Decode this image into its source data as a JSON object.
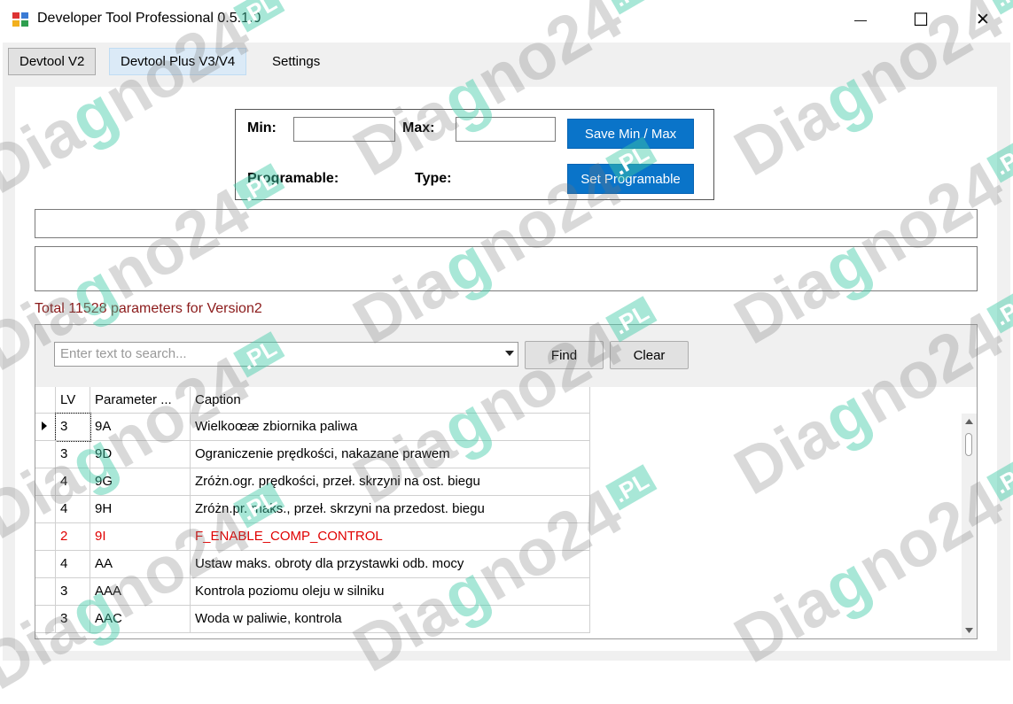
{
  "window": {
    "title": "Developer Tool Professional 0.5.1.0",
    "minimize_glyph": "—",
    "maximize_glyph": "☐",
    "close_glyph": "✕"
  },
  "tabs": [
    {
      "label": "Devtool V2"
    },
    {
      "label": "Devtool Plus V3/V4"
    },
    {
      "label": "Settings"
    }
  ],
  "minmax": {
    "min_label": "Min:",
    "max_label": "Max:",
    "min_value": "",
    "max_value": "",
    "programable_label": "Programable:",
    "type_label": "Type:",
    "save_button": "Save Min / Max",
    "set_button": "Set Programable"
  },
  "summary": "Total 11528 parameters for Version2",
  "grid": {
    "search_placeholder": "Enter text to search...",
    "find_button": "Find",
    "clear_button": "Clear",
    "columns": [
      "LV",
      "Parameter ...",
      "Caption"
    ],
    "rows": [
      {
        "lv": "3",
        "param": "9A",
        "caption": "Wielkoœæ zbiornika paliwa",
        "red": false,
        "current": true
      },
      {
        "lv": "3",
        "param": "9D",
        "caption": "Ograniczenie prędkości, nakazane prawem",
        "red": false,
        "current": false
      },
      {
        "lv": "4",
        "param": "9G",
        "caption": "Zróżn.ogr. prędkości, przeł. skrzyni na ost. biegu",
        "red": false,
        "current": false
      },
      {
        "lv": "4",
        "param": "9H",
        "caption": "Zróżn.pr. maks., przeł. skrzyni na przedost. biegu",
        "red": false,
        "current": false
      },
      {
        "lv": "2",
        "param": "9I",
        "caption": "F_ENABLE_COMP_CONTROL",
        "red": true,
        "current": false
      },
      {
        "lv": "4",
        "param": "AA",
        "caption": "Ustaw maks. obroty dla przystawki odb. mocy",
        "red": false,
        "current": false
      },
      {
        "lv": "3",
        "param": "AAA",
        "caption": "Kontrola poziomu oleju w silniku",
        "red": false,
        "current": false
      },
      {
        "lv": "3",
        "param": "AAC",
        "caption": "Woda w paliwie, kontrola",
        "red": false,
        "current": false
      }
    ]
  },
  "watermark": {
    "text": "Diagno24",
    "suffix": ".PL",
    "accent": "#3ec9a7"
  },
  "colors": {
    "button_blue": "#0a74c9",
    "summary_red": "#8b1a1a",
    "row_red": "#e00000"
  }
}
